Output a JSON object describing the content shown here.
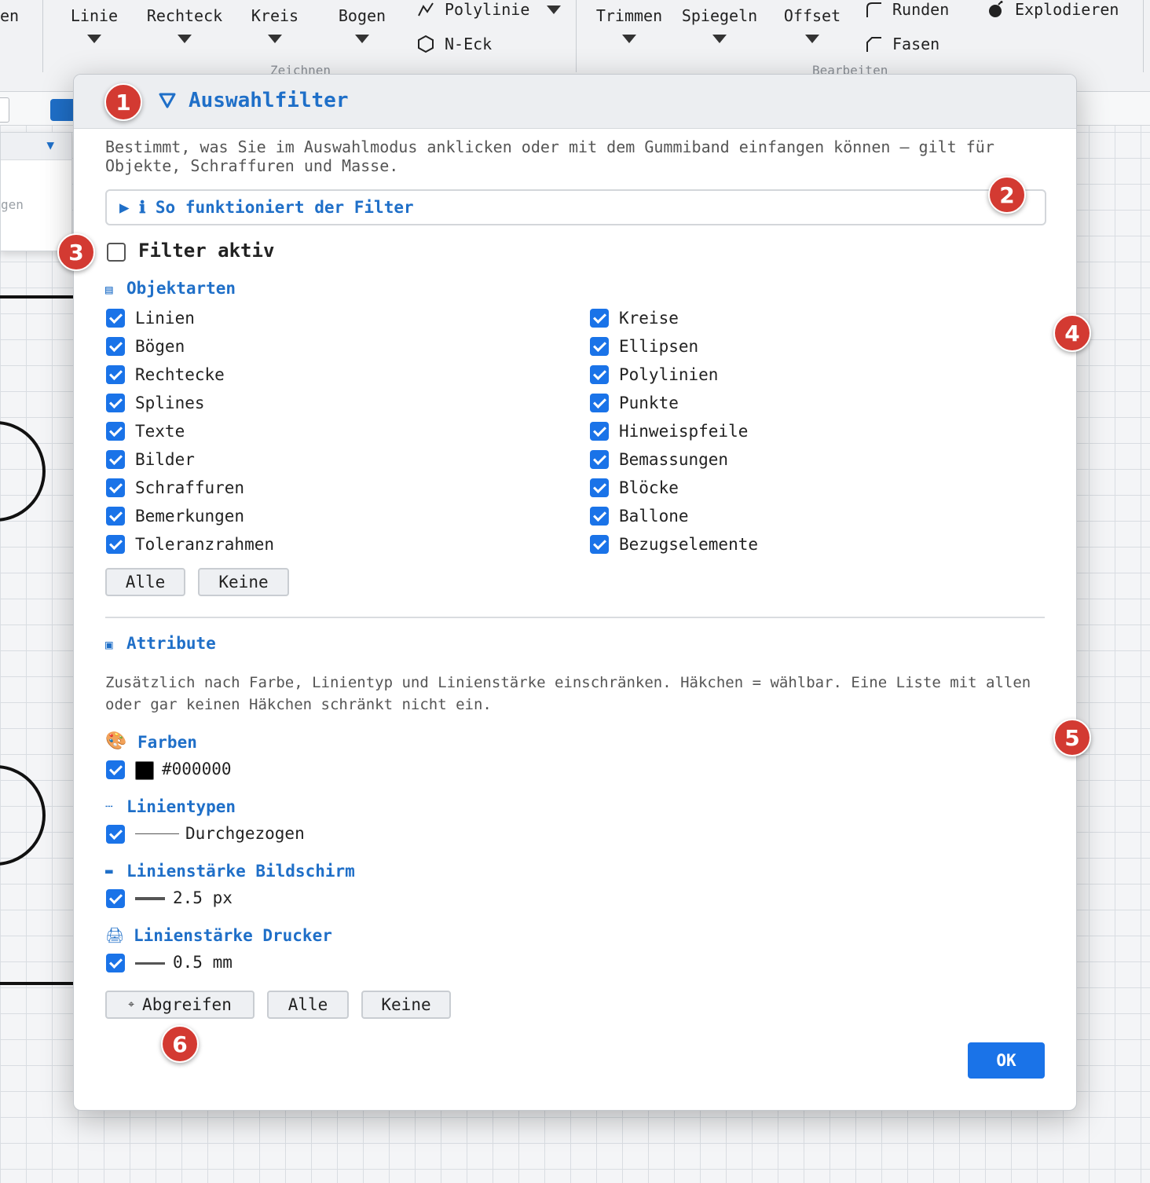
{
  "ribbon": {
    "cut_left_label": "en",
    "draw_tools": [
      {
        "label": "Linie"
      },
      {
        "label": "Rechteck"
      },
      {
        "label": "Kreis"
      },
      {
        "label": "Bogen"
      }
    ],
    "polyline_label": "Polylinie",
    "ngon_label": "N-Eck",
    "draw_group_label": "Zeichnen",
    "edit_tools": [
      {
        "label": "Trimmen"
      },
      {
        "label": "Spiegeln"
      },
      {
        "label": "Offset"
      }
    ],
    "round_label": "Runden",
    "chamfer_label": "Fasen",
    "explode_label": "Explodieren",
    "edit_group_label": "Bearbeiten"
  },
  "side_panel": {
    "text": "gen"
  },
  "dialog": {
    "title": "Auswahlfilter",
    "description": "Bestimmt, was Sie im Auswahlmodus anklicken oder mit dem Gummiband einfangen können — gilt für Objekte, Schraffuren und Masse.",
    "info_toggle": "▶ ℹ So funktioniert der Filter",
    "filter_active_label": "Filter aktiv",
    "filter_active_checked": false,
    "object_types_title": "Objektarten",
    "object_types_left": [
      {
        "label": "Linien",
        "checked": true
      },
      {
        "label": "Bögen",
        "checked": true
      },
      {
        "label": "Rechtecke",
        "checked": true
      },
      {
        "label": "Splines",
        "checked": true
      },
      {
        "label": "Texte",
        "checked": true
      },
      {
        "label": "Bilder",
        "checked": true
      },
      {
        "label": "Schraffuren",
        "checked": true
      },
      {
        "label": "Bemerkungen",
        "checked": true
      },
      {
        "label": "Toleranzrahmen",
        "checked": true
      }
    ],
    "object_types_right": [
      {
        "label": "Kreise",
        "checked": true
      },
      {
        "label": "Ellipsen",
        "checked": true
      },
      {
        "label": "Polylinien",
        "checked": true
      },
      {
        "label": "Punkte",
        "checked": true
      },
      {
        "label": "Hinweispfeile",
        "checked": true
      },
      {
        "label": "Bemassungen",
        "checked": true
      },
      {
        "label": "Blöcke",
        "checked": true
      },
      {
        "label": "Ballone",
        "checked": true
      },
      {
        "label": "Bezugselemente",
        "checked": true
      }
    ],
    "all_button": "Alle",
    "none_button": "Keine",
    "attributes_title": "Attribute",
    "attributes_description": "Zusätzlich nach Farbe, Linientyp und Linienstärke einschränken. Häkchen = wählbar. Eine Liste mit allen oder gar keinen Häkchen schränkt nicht ein.",
    "colors_title": "Farben",
    "colors": [
      {
        "label": "#000000",
        "swatch": "#000000",
        "checked": true
      }
    ],
    "linetypes_title": "Linientypen",
    "linetypes": [
      {
        "label": "Durchgezogen",
        "checked": true
      }
    ],
    "screen_width_title": "Linienstärke Bildschirm",
    "screen_widths": [
      {
        "label": "2.5 px",
        "checked": true
      }
    ],
    "printer_width_title": "Linienstärke Drucker",
    "printer_widths": [
      {
        "label": "0.5 mm",
        "checked": true
      }
    ],
    "pick_button": "Abgreifen",
    "attr_all_button": "Alle",
    "attr_none_button": "Keine",
    "ok_button": "OK"
  },
  "markers": [
    "1",
    "2",
    "3",
    "4",
    "5",
    "6"
  ],
  "colors": {
    "accent": "#1f6fc8",
    "checkbox": "#1a73e8",
    "marker": "#d33a32"
  }
}
